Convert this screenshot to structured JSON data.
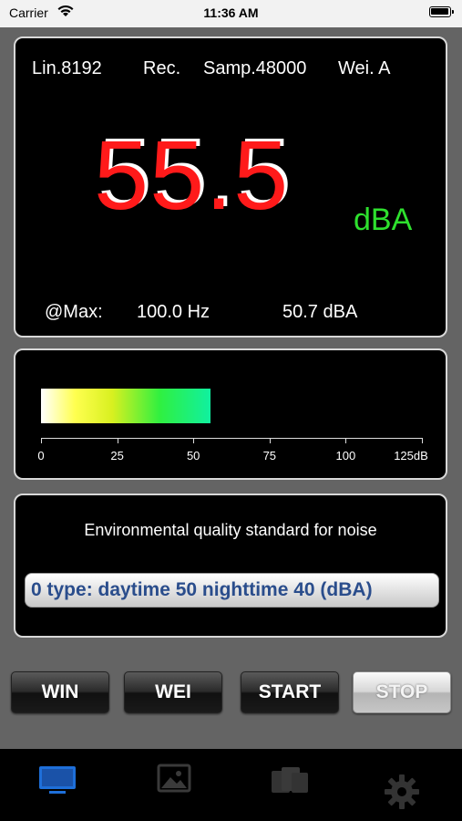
{
  "status_bar": {
    "carrier": "Carrier",
    "time": "11:36 AM"
  },
  "measurement": {
    "lin": "Lin.8192",
    "mode": "Rec.",
    "samp": "Samp.48000",
    "weighting": "Wei. A",
    "value": "55.5",
    "unit": "dBA",
    "max_label": "@Max:",
    "max_freq": "100.0 Hz",
    "max_level": "50.7 dBA"
  },
  "level_meter": {
    "value": 55.5,
    "scale_max": 125,
    "tick_labels": [
      "0",
      "25",
      "50",
      "75",
      "100",
      "125dB"
    ]
  },
  "standard": {
    "title": "Environmental quality standard for noise",
    "selected": "0 type: daytime 50 nighttime 40 (dBA)"
  },
  "buttons": {
    "win": "WIN",
    "wei": "WEI",
    "start": "START",
    "stop": "STOP"
  },
  "tabs": [
    {
      "icon": "monitor-icon",
      "active": true
    },
    {
      "icon": "image-icon",
      "active": false
    },
    {
      "icon": "files-icon",
      "active": false
    },
    {
      "icon": "gear-icon",
      "active": false
    }
  ],
  "colors": {
    "value": "#ff1a1a",
    "unit": "#2ee02e",
    "select_text": "#2a4d8c",
    "tab_active": "#1e6fd9",
    "tab_inactive": "#333333"
  }
}
